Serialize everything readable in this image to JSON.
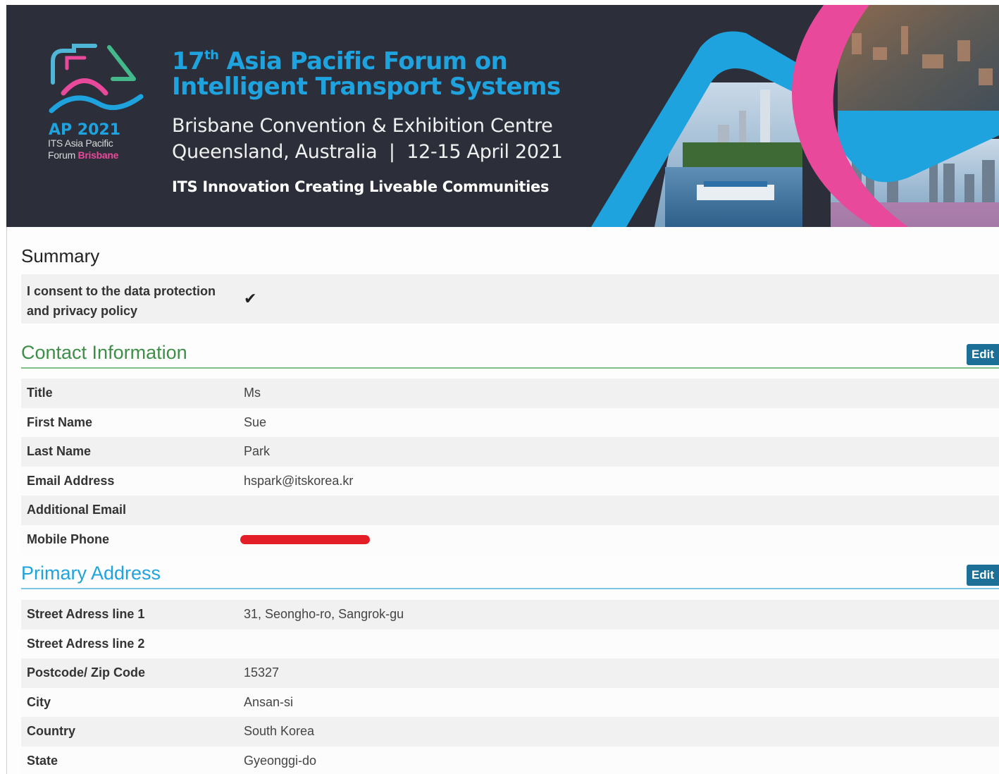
{
  "banner": {
    "logo": {
      "year": "AP 2021",
      "line1": "ITS Asia Pacific",
      "line2_prefix": "Forum",
      "line2_city": "Brisbane"
    },
    "title_line1_number": "17",
    "title_line1_suffix": "th",
    "title_line1_rest": " Asia Pacific Forum on",
    "title_line2": "Intelligent Transport Systems",
    "venue": "Brisbane Convention & Exhibition Centre",
    "location_dates": "Queensland, Australia  |  12-15 April 2021",
    "tagline": "ITS Innovation Creating Liveable Communities",
    "colors": {
      "background": "#2c2f3a",
      "accent_blue": "#1fa3df",
      "accent_pink": "#e8499a"
    }
  },
  "summary": {
    "title": "Summary",
    "consent_label": "I consent to the data protection and privacy policy",
    "consent_icon": "check-icon",
    "consent_glyph": "✔"
  },
  "contact": {
    "title": "Contact Information",
    "edit_label": "Edit",
    "rows": [
      {
        "label": "Title",
        "value": "Ms"
      },
      {
        "label": "First Name",
        "value": "Sue"
      },
      {
        "label": "Last Name",
        "value": "Park"
      },
      {
        "label": "Email Address",
        "value": "hspark@itskorea.kr"
      },
      {
        "label": "Additional Email",
        "value": ""
      },
      {
        "label": "Mobile Phone",
        "value": ""
      }
    ]
  },
  "address": {
    "title": "Primary Address",
    "edit_label": "Edit",
    "rows": [
      {
        "label": "Street Adress line 1",
        "value": "31, Seongho-ro, Sangrok-gu"
      },
      {
        "label": "Street Adress line 2",
        "value": ""
      },
      {
        "label": "Postcode/ Zip Code",
        "value": "15327"
      },
      {
        "label": "City",
        "value": "Ansan-si"
      },
      {
        "label": "Country",
        "value": "South Korea"
      },
      {
        "label": "State",
        "value": "Gyeonggi-do"
      }
    ]
  }
}
